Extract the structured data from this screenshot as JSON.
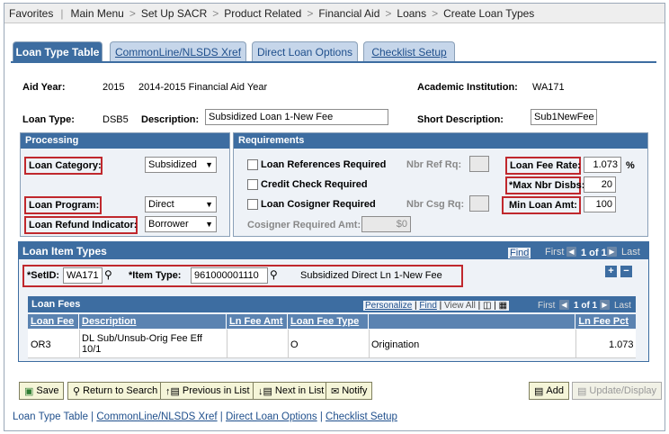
{
  "breadcrumb": [
    "Favorites",
    "Main Menu",
    "Set Up SACR",
    "Product Related",
    "Financial Aid",
    "Loans",
    "Create Loan Types"
  ],
  "tabs": [
    {
      "label": "Loan Type Table"
    },
    {
      "label": "CommonLine/NLSDS Xref"
    },
    {
      "label": "Direct Loan Options"
    },
    {
      "label": "Checklist Setup"
    }
  ],
  "header": {
    "aid_year_label": "Aid Year:",
    "aid_year": "2015",
    "aid_year_desc": "2014-2015 Financial Aid Year",
    "institution_label": "Academic Institution:",
    "institution": "WA171",
    "loan_type_label": "Loan Type:",
    "loan_type": "DSB5",
    "description_label": "Description:",
    "description": "Subsidized Loan 1-New Fee",
    "short_desc_label": "Short Description:",
    "short_desc": "Sub1NewFee"
  },
  "processing": {
    "title": "Processing",
    "loan_category_label": "Loan Category:",
    "loan_category": "Subsidized",
    "loan_program_label": "Loan Program:",
    "loan_program": "Direct",
    "refund_label": "Loan Refund Indicator:",
    "refund": "Borrower"
  },
  "requirements": {
    "title": "Requirements",
    "loan_refs_label": "Loan References Required",
    "nbr_ref_label": "Nbr Ref Rq:",
    "credit_check_label": "Credit Check Required",
    "cosigner_label": "Loan Cosigner Required",
    "nbr_csg_label": "Nbr Csg Rq:",
    "cosigner_amt_label": "Cosigner Required Amt:",
    "cosigner_amt": "$0",
    "fee_rate_label": "Loan Fee Rate:",
    "fee_rate": "1.073",
    "pct": "%",
    "max_disbs_label": "*Max Nbr Disbs:",
    "max_disbs": "20",
    "min_amt_label": "Min Loan Amt:",
    "min_amt": "100"
  },
  "item_types": {
    "title": "Loan Item Types",
    "find": "Find",
    "first": "First",
    "count": "1 of 1",
    "last": "Last",
    "setid_label": "*SetID:",
    "setid": "WA171",
    "item_type_label": "*Item Type:",
    "item_type": "961000001110",
    "item_desc": "Subsidized Direct Ln 1-New Fee"
  },
  "fees": {
    "title": "Loan Fees",
    "personalize": "Personalize",
    "find": "Find",
    "view_all": "View All",
    "first": "First",
    "count": "1 of 1",
    "last": "Last",
    "columns": [
      "Loan Fee",
      "Description",
      "Ln Fee Amt",
      "Loan Fee Type",
      "Ln Fee Pct"
    ],
    "row": {
      "loan_fee": "OR3",
      "desc_line1": "DL Sub/Unsub-Orig Fee Eff",
      "desc_line2": "10/1",
      "amt": "",
      "type": "O",
      "type_desc": "Origination",
      "pct": "1.073"
    }
  },
  "toolbar": {
    "save": "Save",
    "return": "Return to Search",
    "previous": "Previous in List",
    "next": "Next in List",
    "notify": "Notify",
    "add": "Add",
    "update": "Update/Display"
  },
  "footer_links": [
    "Loan Type Table",
    "CommonLine/NLSDS Xref",
    "Direct Loan Options",
    "Checklist Setup"
  ]
}
